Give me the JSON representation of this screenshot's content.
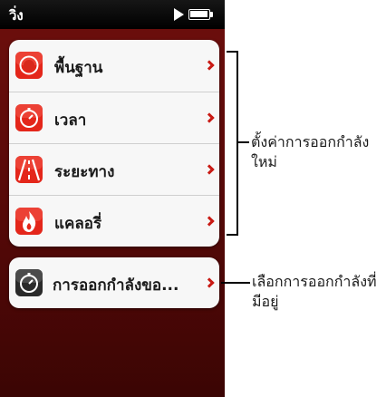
{
  "status_bar": {
    "title": "วิ่ง"
  },
  "menu": {
    "items": [
      {
        "label": "พื้นฐาน",
        "icon": "target-icon",
        "color": "#e4261a"
      },
      {
        "label": "เวลา",
        "icon": "stopwatch-icon",
        "color": "#e4261a"
      },
      {
        "label": "ระยะทาง",
        "icon": "road-icon",
        "color": "#e4261a"
      },
      {
        "label": "แคลอรี่",
        "icon": "flame-icon",
        "color": "#e4261a"
      }
    ],
    "history_item": {
      "label": "การออกกำลังขอ...",
      "icon": "stopwatch-icon",
      "color": "#222222"
    }
  },
  "callouts": {
    "new_workout": "ตั้งค่าการออกกำลังใหม่",
    "preset_workout": "เลือกการออกกำลังที่มีอยู่"
  },
  "colors": {
    "accent": "#c91a14",
    "background": "#5a0a09"
  }
}
